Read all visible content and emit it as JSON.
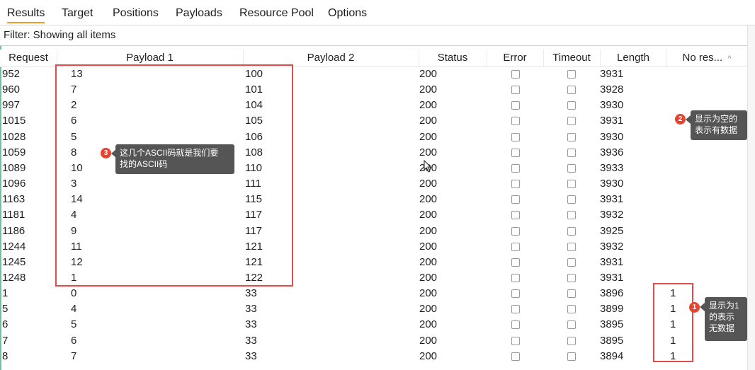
{
  "tabs": [
    "Results",
    "Target",
    "Positions",
    "Payloads",
    "Resource Pool",
    "Options"
  ],
  "filter": "Filter: Showing all items",
  "columns": [
    "Request",
    "Payload 1",
    "Payload 2",
    "Status",
    "Error",
    "Timeout",
    "Length",
    "No res..."
  ],
  "sort_indicator": "^",
  "rows": [
    {
      "request": "952",
      "payload1": "13",
      "payload2": "100",
      "status": "200",
      "length": "3931",
      "nores": ""
    },
    {
      "request": "960",
      "payload1": "7",
      "payload2": "101",
      "status": "200",
      "length": "3928",
      "nores": ""
    },
    {
      "request": "997",
      "payload1": "2",
      "payload2": "104",
      "status": "200",
      "length": "3930",
      "nores": ""
    },
    {
      "request": "1015",
      "payload1": "6",
      "payload2": "105",
      "status": "200",
      "length": "3931",
      "nores": ""
    },
    {
      "request": "1028",
      "payload1": "5",
      "payload2": "106",
      "status": "200",
      "length": "3930",
      "nores": ""
    },
    {
      "request": "1059",
      "payload1": "8",
      "payload2": "108",
      "status": "200",
      "length": "3936",
      "nores": ""
    },
    {
      "request": "1089",
      "payload1": "10",
      "payload2": "110",
      "status": "200",
      "length": "3933",
      "nores": ""
    },
    {
      "request": "1096",
      "payload1": "3",
      "payload2": "111",
      "status": "200",
      "length": "3930",
      "nores": ""
    },
    {
      "request": "1163",
      "payload1": "14",
      "payload2": "115",
      "status": "200",
      "length": "3931",
      "nores": ""
    },
    {
      "request": "1181",
      "payload1": "4",
      "payload2": "117",
      "status": "200",
      "length": "3932",
      "nores": ""
    },
    {
      "request": "1186",
      "payload1": "9",
      "payload2": "117",
      "status": "200",
      "length": "3925",
      "nores": ""
    },
    {
      "request": "1244",
      "payload1": "11",
      "payload2": "121",
      "status": "200",
      "length": "3932",
      "nores": ""
    },
    {
      "request": "1245",
      "payload1": "12",
      "payload2": "121",
      "status": "200",
      "length": "3931",
      "nores": ""
    },
    {
      "request": "1248",
      "payload1": "1",
      "payload2": "122",
      "status": "200",
      "length": "3931",
      "nores": ""
    },
    {
      "request": "1",
      "payload1": "0",
      "payload2": "33",
      "status": "200",
      "length": "3896",
      "nores": "1"
    },
    {
      "request": "5",
      "payload1": "4",
      "payload2": "33",
      "status": "200",
      "length": "3899",
      "nores": "1"
    },
    {
      "request": "6",
      "payload1": "5",
      "payload2": "33",
      "status": "200",
      "length": "3895",
      "nores": "1"
    },
    {
      "request": "7",
      "payload1": "6",
      "payload2": "33",
      "status": "200",
      "length": "3895",
      "nores": "1"
    },
    {
      "request": "8",
      "payload1": "7",
      "payload2": "33",
      "status": "200",
      "length": "3894",
      "nores": "1"
    }
  ],
  "annotations": {
    "a1": {
      "num": "1",
      "text": [
        "显示为1",
        "的表示",
        "无数据"
      ]
    },
    "a2": {
      "num": "2",
      "text": [
        "显示为空的",
        "表示有数据"
      ]
    },
    "a3": {
      "num": "3",
      "text": [
        "这几个ASCII码就是我们要",
        "找的ASCII码"
      ]
    }
  },
  "colors": {
    "accent_tab": "#f39a2b",
    "annotation_box": "#e34c4c",
    "badge": "#e8432f",
    "note_bg": "#555555"
  }
}
